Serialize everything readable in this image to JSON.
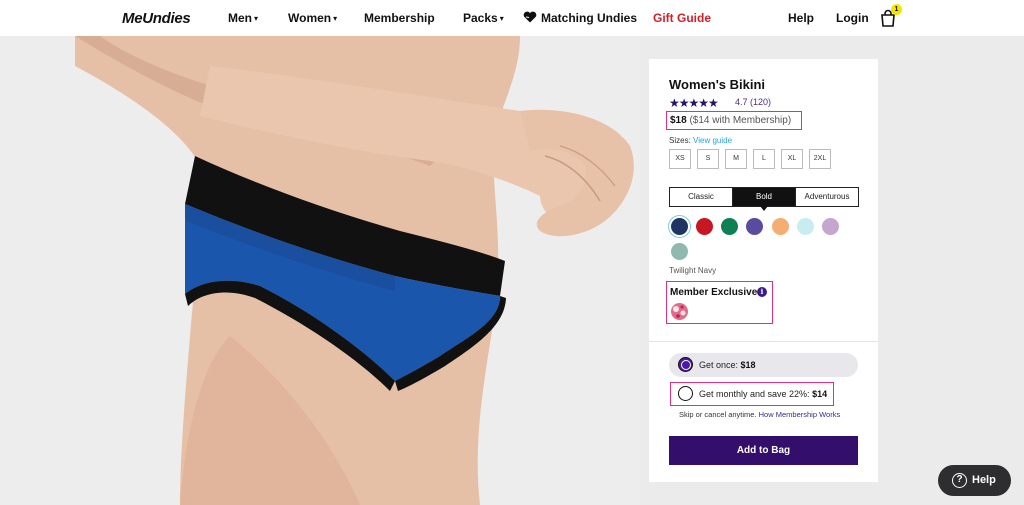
{
  "nav": {
    "logo": "MeUndies",
    "items": {
      "men": "Men",
      "women": "Women",
      "membership": "Membership",
      "packs": "Packs",
      "matching": "Matching Undies",
      "gift": "Gift Guide",
      "help": "Help",
      "login": "Login"
    },
    "bag_count": "1"
  },
  "hero": {
    "image": "model wearing blue bikini with black waistband"
  },
  "product": {
    "title": "Women's Bikini",
    "stars": "★★★★★",
    "rating": "4.7 (120)",
    "price": "$18",
    "member_price": "($14 with Membership)",
    "sizes_label": "Sizes:",
    "view_guide": "View guide",
    "sizes": [
      "XS",
      "S",
      "M",
      "L",
      "XL",
      "2XL"
    ],
    "tabs": [
      "Classic",
      "Bold",
      "Adventurous"
    ],
    "active_tab": "Bold",
    "colors": [
      "#1f3461",
      "#c81624",
      "#0f8054",
      "#5a4aa0",
      "#f6ad74",
      "#c8ecf0",
      "#c4a6cf",
      "#8fb9ae"
    ],
    "selected_color_name": "Twilight Navy",
    "member_exclusive_label": "Member Exclusive",
    "purchase": {
      "once_label": "Get once:",
      "once_price": "$18",
      "monthly_label": "Get monthly and save 22%:",
      "monthly_price": "$14",
      "skip_text": "Skip or cancel anytime.",
      "how_link": "How Membership Works"
    },
    "add_to_bag": "Add to Bag"
  },
  "help_button": "Help",
  "colors": {
    "brand": "#330e6b",
    "highlight": "#e0317f",
    "gift": "#d2202b"
  }
}
